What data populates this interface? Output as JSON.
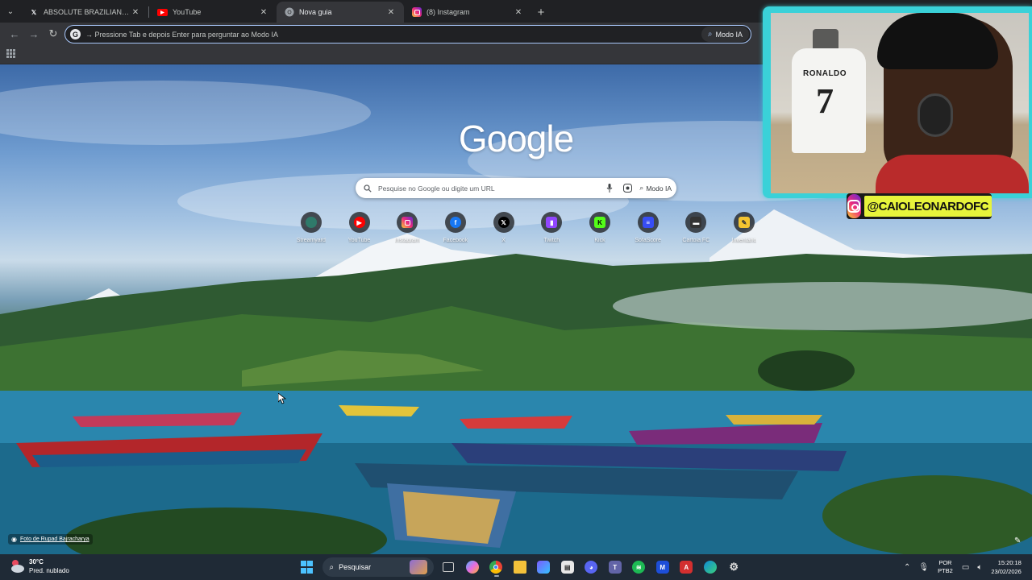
{
  "browser": {
    "tabs": [
      {
        "title": "ABSOLUTE BRAZILIAN on X: \"Q...",
        "icon": "x-icon",
        "active": false
      },
      {
        "title": "YouTube",
        "icon": "youtube-icon",
        "active": false
      },
      {
        "title": "Nova guia",
        "icon": "chrome-icon",
        "active": true
      },
      {
        "title": "(8) Instagram",
        "icon": "instagram-icon",
        "active": false
      }
    ],
    "omnibox": {
      "text": "→ Pressione Tab e depois Enter para perguntar ao Modo IA",
      "ai_button": "Modo IA"
    }
  },
  "new_tab_page": {
    "logo_text": "Google",
    "search": {
      "placeholder": "Pesquise no Google ou digite um URL",
      "ai_button": "Modo IA"
    },
    "shortcuts": [
      {
        "label": "Streamyard",
        "icon": "streamyard-icon",
        "color": "#2f7a6a"
      },
      {
        "label": "YouTube",
        "icon": "youtube-icon",
        "color": "#ff0000"
      },
      {
        "label": "Instagram",
        "icon": "instagram-icon",
        "color": "#d62976"
      },
      {
        "label": "Facebook",
        "icon": "facebook-icon",
        "color": "#1877f2"
      },
      {
        "label": "X",
        "icon": "x-icon",
        "color": "#000000"
      },
      {
        "label": "Twitch",
        "icon": "twitch-icon",
        "color": "#9146ff"
      },
      {
        "label": "Kick",
        "icon": "kick-icon",
        "color": "#53fc18"
      },
      {
        "label": "SofaScore",
        "icon": "sofascore-icon",
        "color": "#374df5"
      },
      {
        "label": "Cartola FC",
        "icon": "cartola-icon",
        "color": "#333333"
      },
      {
        "label": "Inventário",
        "icon": "notes-icon",
        "color": "#f4c430"
      }
    ],
    "photo_credit": "Foto de Rupad Bajracharya"
  },
  "webcam_overlay": {
    "handle": "@CAIOLEONARDOFC",
    "jersey_name": "RONALDO",
    "jersey_number": "7",
    "frame_color": "#3ad1d8",
    "handle_bg": "#e7f43b"
  },
  "taskbar": {
    "weather": {
      "temp": "30°C",
      "condition": "Pred. nublado"
    },
    "search_label": "Pesquisar",
    "language": {
      "line1": "POR",
      "line2": "PTB2"
    },
    "clock": {
      "time": "15:20:18",
      "date": "23/02/2026"
    }
  }
}
